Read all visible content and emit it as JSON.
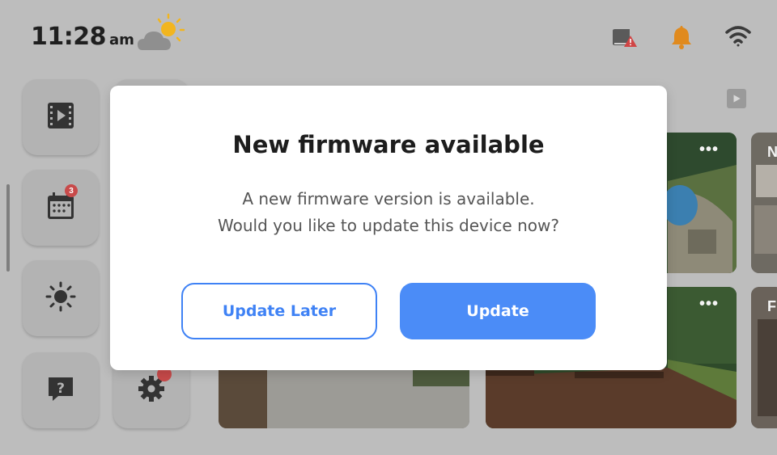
{
  "status_bar": {
    "time": "11:28",
    "ampm": "am",
    "weather_icon": "partly-sunny-icon",
    "icons": [
      "book-warning-icon",
      "bell-icon",
      "wifi-icon"
    ]
  },
  "sidebar": {
    "items": [
      {
        "icon": "video-icon"
      },
      {
        "icon": "calendar-icon",
        "badge": "3"
      },
      {
        "icon": "brightness-icon"
      },
      {
        "icon": "help-icon"
      },
      {
        "icon": "settings-icon"
      }
    ]
  },
  "cameras": {
    "more_label": "•••",
    "labels": [
      "N",
      "F"
    ]
  },
  "modal": {
    "title": "New firmware available",
    "line1": "A new firmware version is available.",
    "line2": "Would you like to update this device now?",
    "later_label": "Update Later",
    "update_label": "Update"
  },
  "colors": {
    "accent": "#4b8cf7",
    "badge": "#c84a4a",
    "bell": "#e08a1e"
  }
}
